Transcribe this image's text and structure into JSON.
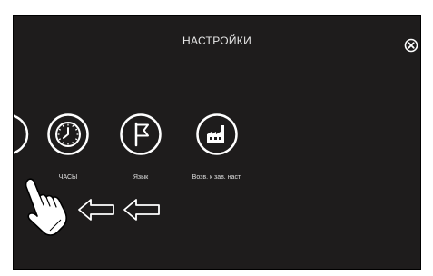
{
  "header": {
    "title": "НАСТРОЙКИ",
    "close_icon": "close-circle-icon"
  },
  "settings_items": [
    {
      "label": "",
      "icon": "partial-circle-icon"
    },
    {
      "label": "ЧАСЫ",
      "icon": "clock-icon"
    },
    {
      "label": "Язык",
      "icon": "flag-icon"
    },
    {
      "label": "Возв. к зав. наст.",
      "icon": "factory-icon"
    }
  ],
  "gesture": {
    "hand_icon": "pointing-hand-icon",
    "arrow_icon": "left-arrow-icon"
  },
  "colors": {
    "background": "#1e1c1c",
    "foreground": "#ffffff"
  }
}
